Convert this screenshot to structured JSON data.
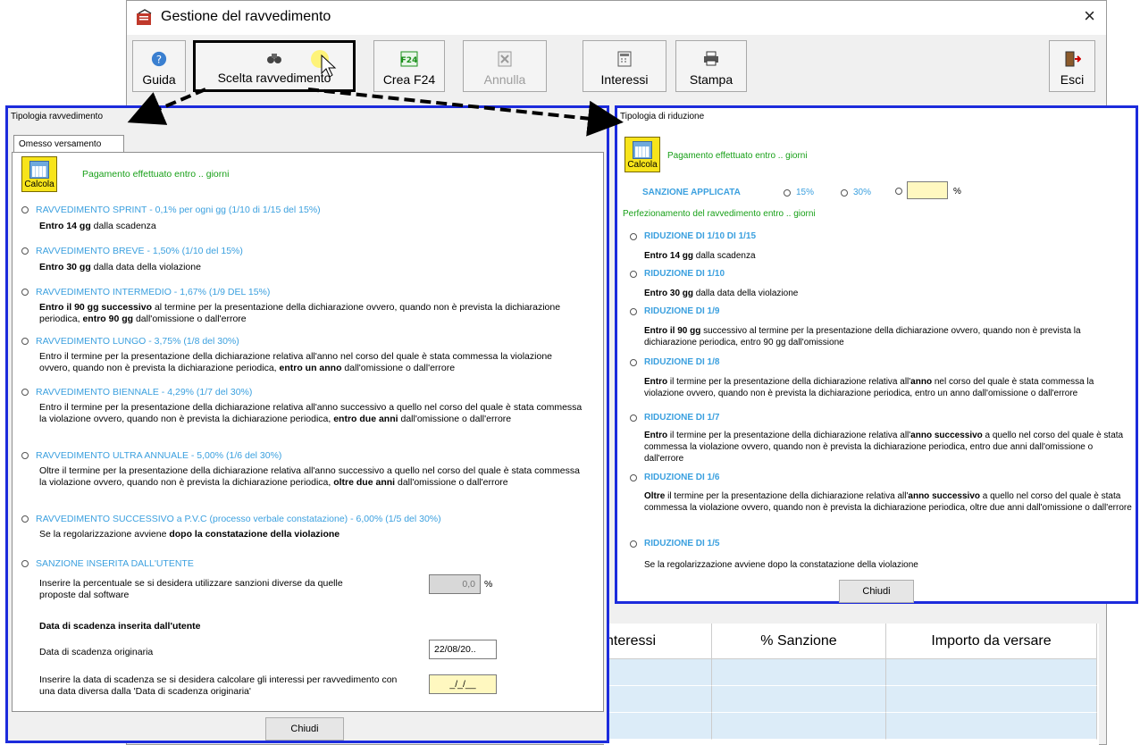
{
  "window": {
    "title": "Gestione del ravvedimento",
    "close": "×"
  },
  "toolbar": {
    "guida": "Guida",
    "scelta": "Scelta ravvedimento",
    "crea_f24": "Crea F24",
    "annulla": "Annulla",
    "interessi": "Interessi",
    "stampa": "Stampa",
    "esci": "Esci"
  },
  "left": {
    "title": "Tipologia ravvedimento",
    "tab": "Omesso versamento",
    "calc_label": "Calcola",
    "heading": "Pagamento effettuato entro .. giorni",
    "options": [
      {
        "label": "RAVVEDIMENTO SPRINT - 0,1% per ogni gg (1/10 di 1/15 del 15%)",
        "b1": "Entro 14 gg",
        "t1": " dalla scadenza"
      },
      {
        "label": "RAVVEDIMENTO BREVE - 1,50% (1/10 del 15%)",
        "b1": "Entro 30 gg",
        "t1": " dalla data della violazione"
      },
      {
        "label": "RAVVEDIMENTO INTERMEDIO - 1,67% (1/9 DEL 15%)",
        "b1": "Entro il 90 gg successivo",
        "t1": " al termine per la presentazione della dichiarazione ovvero, quando non è prevista la dichiarazione periodica, ",
        "b2": "entro 90 gg",
        "t2": " dall'omissione o dall'errore"
      },
      {
        "label": "RAVVEDIMENTO LUNGO - 3,75% (1/8 del 30%)",
        "t0": "Entro il termine per la presentazione della dichiarazione relativa all'anno nel corso del quale è stata commessa la violazione ovvero, quando non è prevista la dichiarazione periodica, ",
        "b1": "entro un anno",
        "t1": " dall'omissione o dall'errore"
      },
      {
        "label": "RAVVEDIMENTO BIENNALE - 4,29% (1/7 del 30%)",
        "t0": "Entro il termine per la presentazione della dichiarazione relativa all'anno successivo a quello nel corso del quale è stata commessa la violazione ovvero, quando non è prevista la dichiarazione periodica, ",
        "b1": "entro due anni",
        "t1": "  dall'omissione o dall'errore"
      },
      {
        "label": "RAVVEDIMENTO ULTRA ANNUALE - 5,00% (1/6 del 30%)",
        "t0": "Oltre il termine per la presentazione della dichiarazione relativa all'anno successivo a quello nel corso del quale è stata commessa la violazione ovvero, quando non è prevista la dichiarazione periodica, ",
        "b1": "oltre due anni",
        "t1": "  dall'omissione o dall'errore"
      },
      {
        "label": "RAVVEDIMENTO SUCCESSIVO a P.V.C (processo verbale constatazione) - 6,00% (1/5 del 30%)",
        "t0": "Se la regolarizzazione avviene ",
        "b1": "dopo la constatazione della violazione"
      },
      {
        "label": "SANZIONE INSERITA DALL'UTENTE"
      }
    ],
    "custom_pct_text": "Inserire  la percentuale se si desidera utilizzare sanzioni diverse da quelle proposte dal software",
    "custom_pct_value": "0,0",
    "pct": "%",
    "due_date_heading": "Data di scadenza inserita dall'utente",
    "orig_due_label": "Data di scadenza originaria",
    "orig_due_value": "22/08/20..",
    "alt_due_text": "Inserire la data di scadenza se si desidera calcolare gli interessi per ravvedimento con una data diversa dalla 'Data di scadenza originaria'",
    "alt_due_value": "_/_/__",
    "close": "Chiudi"
  },
  "right": {
    "title": "Tipologia di riduzione",
    "calc_label": "Calcola",
    "heading": "Pagamento effettuato entro .. giorni",
    "sanzione_label": "SANZIONE APPLICATA",
    "opt15": "15%",
    "opt30": "30%",
    "pct": "%",
    "perf_heading": "Perfezionamento del ravvedimento entro .. giorni",
    "options": [
      {
        "label": "RIDUZIONE DI 1/10 DI 1/15",
        "b1": "Entro 14 gg",
        "t1": "  dalla scadenza"
      },
      {
        "label": "RIDUZIONE DI 1/10",
        "b1": "Entro 30 gg",
        "t1": "  dalla data della violazione"
      },
      {
        "label": "RIDUZIONE DI 1/9",
        "b1": "Entro il 90 gg",
        "t1": "  successivo al termine per la presentazione della dichiarazione ovvero, quando non è prevista la dichiarazione periodica, entro 90 gg dall'omissione"
      },
      {
        "label": "RIDUZIONE DI 1/8",
        "b1": "Entro",
        "t1": " il termine per la presentazione della dichiarazione relativa all'",
        "b2": "anno",
        "t2": "  nel corso del quale è stata commessa la violazione ovvero, quando non è prevista la dichiarazione periodica, entro un anno dall'omissione o dall'errore"
      },
      {
        "label": "RIDUZIONE DI 1/7",
        "b1": "Entro",
        "t1": " il termine per la presentazione della dichiarazione relativa all'",
        "b2": "anno successivo",
        "t2": " a quello nel corso del quale è stata commessa la violazione ovvero, quando non è prevista la dichiarazione periodica, entro due anni dall'omissione o dall'errore"
      },
      {
        "label": "RIDUZIONE DI 1/6",
        "b1": "Oltre",
        "t1": " il termine per la presentazione della dichiarazione relativa all'",
        "b2": "anno successivo",
        "t2": " a quello nel corso del quale è stata commessa la violazione ovvero, quando non è prevista la dichiarazione periodica, oltre due anni dall'omissione o dall'errore"
      },
      {
        "label": "RIDUZIONE DI 1/5",
        "t1": "Se la regolarizzazione avviene dopo la constatazione della violazione"
      }
    ],
    "close": "Chiudi"
  },
  "table": {
    "headers": [
      "nteressi",
      "% Sanzione",
      "Importo da versare"
    ]
  },
  "colors": {
    "dialog_border": "#1c2bdc",
    "option_blue": "#3ba0df",
    "green": "#18a018",
    "red": "#ee0000",
    "calc_yellow": "#f7e41b"
  }
}
